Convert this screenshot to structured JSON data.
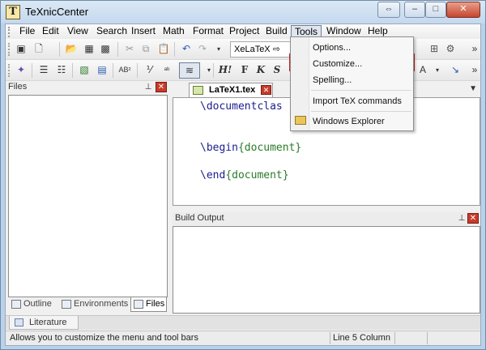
{
  "app": {
    "title": "TeXnicCenter",
    "icon_glyph": "T"
  },
  "caption_buttons": {
    "restore": "⇔",
    "minimize": "–",
    "maximize": "□",
    "close": "✕"
  },
  "menubar": [
    "File",
    "Edit",
    "View",
    "Search",
    "Insert",
    "Math",
    "Format",
    "Project",
    "Build",
    "Tools",
    "Window",
    "Help"
  ],
  "toolbar1": {
    "combo_value": "XeLaTeX ⇨ PDF",
    "more": "»"
  },
  "toolbar2": {
    "sup_label": "AB²",
    "h_label": "H!",
    "f_label": "F",
    "k_label": "K",
    "s_label": "S",
    "more": "»"
  },
  "files_panel": {
    "title": "Files",
    "tabs": [
      "Outline",
      "Environments",
      "Files"
    ],
    "active_tab": "Files"
  },
  "editor": {
    "tab_label": "LaTeX1.tex",
    "lines": [
      {
        "cmd": "\\documentclas",
        "arg": ""
      },
      {
        "cmd": "\\begin",
        "arg": "{document}"
      },
      {
        "cmd": "\\end",
        "arg": "{document}"
      }
    ]
  },
  "build_output": {
    "title": "Build Output"
  },
  "literature_tab": "Literature",
  "status": {
    "message": "Allows you to customize the menu and tool bars",
    "position": "Line 5 Column"
  },
  "tools_menu": {
    "items": [
      "Options...",
      "Customize...",
      "Spelling...",
      "Import TeX commands",
      "Windows Explorer"
    ],
    "highlighted": "Customize..."
  },
  "colors": {
    "highlight_border": "#c42020",
    "keyword": "#1c1c8f",
    "argument": "#2a7a2a"
  }
}
